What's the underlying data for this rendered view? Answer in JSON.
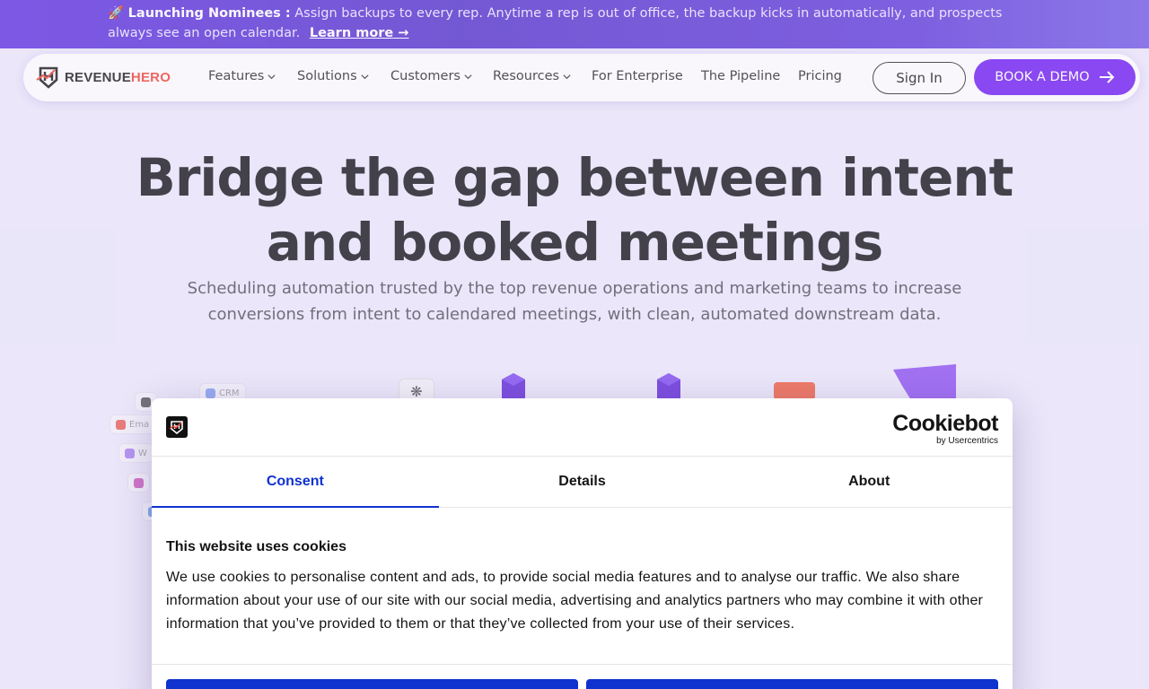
{
  "banner": {
    "emoji": "🚀",
    "strong": "Launching Nominees :",
    "text": " Assign backups to every rep. Anytime a rep is out of office, the backup kicks in automatically, and prospects always see an open calendar.",
    "link": "Learn more →"
  },
  "nav": {
    "logo_part1": "REVENUE",
    "logo_part2": "HERO",
    "items": [
      "Features",
      "Solutions",
      "Customers",
      "Resources",
      "For Enterprise",
      "The Pipeline",
      "Pricing"
    ],
    "sign_in": "Sign In",
    "book_demo": "BOOK A DEMO"
  },
  "hero": {
    "title_line1": "Bridge the gap between intent",
    "title_line2": "and booked meetings",
    "subtitle": "Scheduling automation trusted by the top revenue operations and marketing teams to increase conversions from intent to calendared meetings, with clean, automated downstream data."
  },
  "illustration": {
    "chips": [
      "CRM",
      "Ema",
      "W"
    ]
  },
  "cookie_dialog": {
    "brand": "Cookiebot",
    "brand_sub": "by Usercentrics",
    "tabs": [
      "Consent",
      "Details",
      "About"
    ],
    "active_tab": "Consent",
    "heading": "This website uses cookies",
    "body": "We use cookies to personalise content and ads, to provide social media features and to analyse our traffic. We also share information about your use of our site with our social media, advertising and analytics partners who may combine it with other information that you’ve provided to them or that they’ve collected from your use of their services."
  },
  "colors": {
    "brand_purple": "#6a16f0",
    "cookiebot_blue": "#1032cf",
    "logo_accent": "#ef3e2f"
  }
}
